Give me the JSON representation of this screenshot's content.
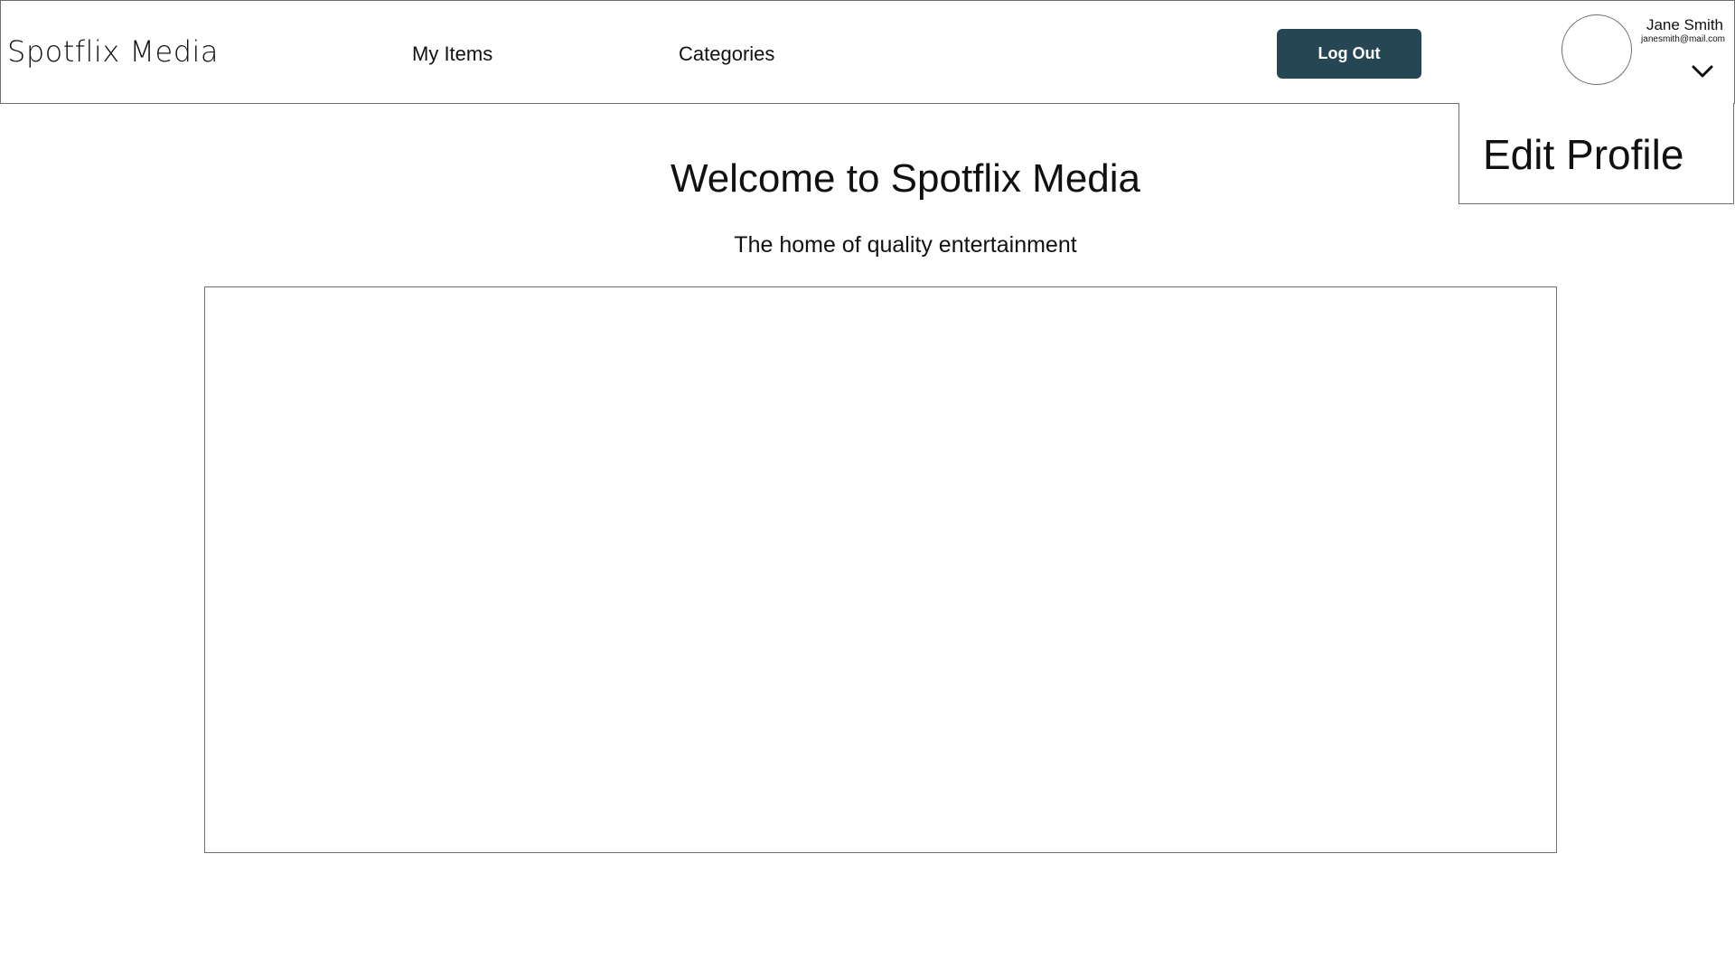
{
  "header": {
    "brand": "Spotflix Media",
    "nav": {
      "my_items": "My Items",
      "categories": "Categories"
    },
    "logout_label": "Log Out",
    "user": {
      "name": "Jane Smith",
      "email": "janesmith@mail.com"
    },
    "icons": {
      "avatar": "avatar-placeholder",
      "menu_toggle": "chevron-down-icon"
    }
  },
  "profile_menu": {
    "items": [
      {
        "label": "Edit Profile"
      }
    ]
  },
  "main": {
    "title": "Welcome to Spotflix Media",
    "subtitle": "The home of quality entertainment"
  },
  "colors": {
    "button_bg": "#264653",
    "button_text": "#ffffff",
    "border": "#6e6e6e"
  }
}
